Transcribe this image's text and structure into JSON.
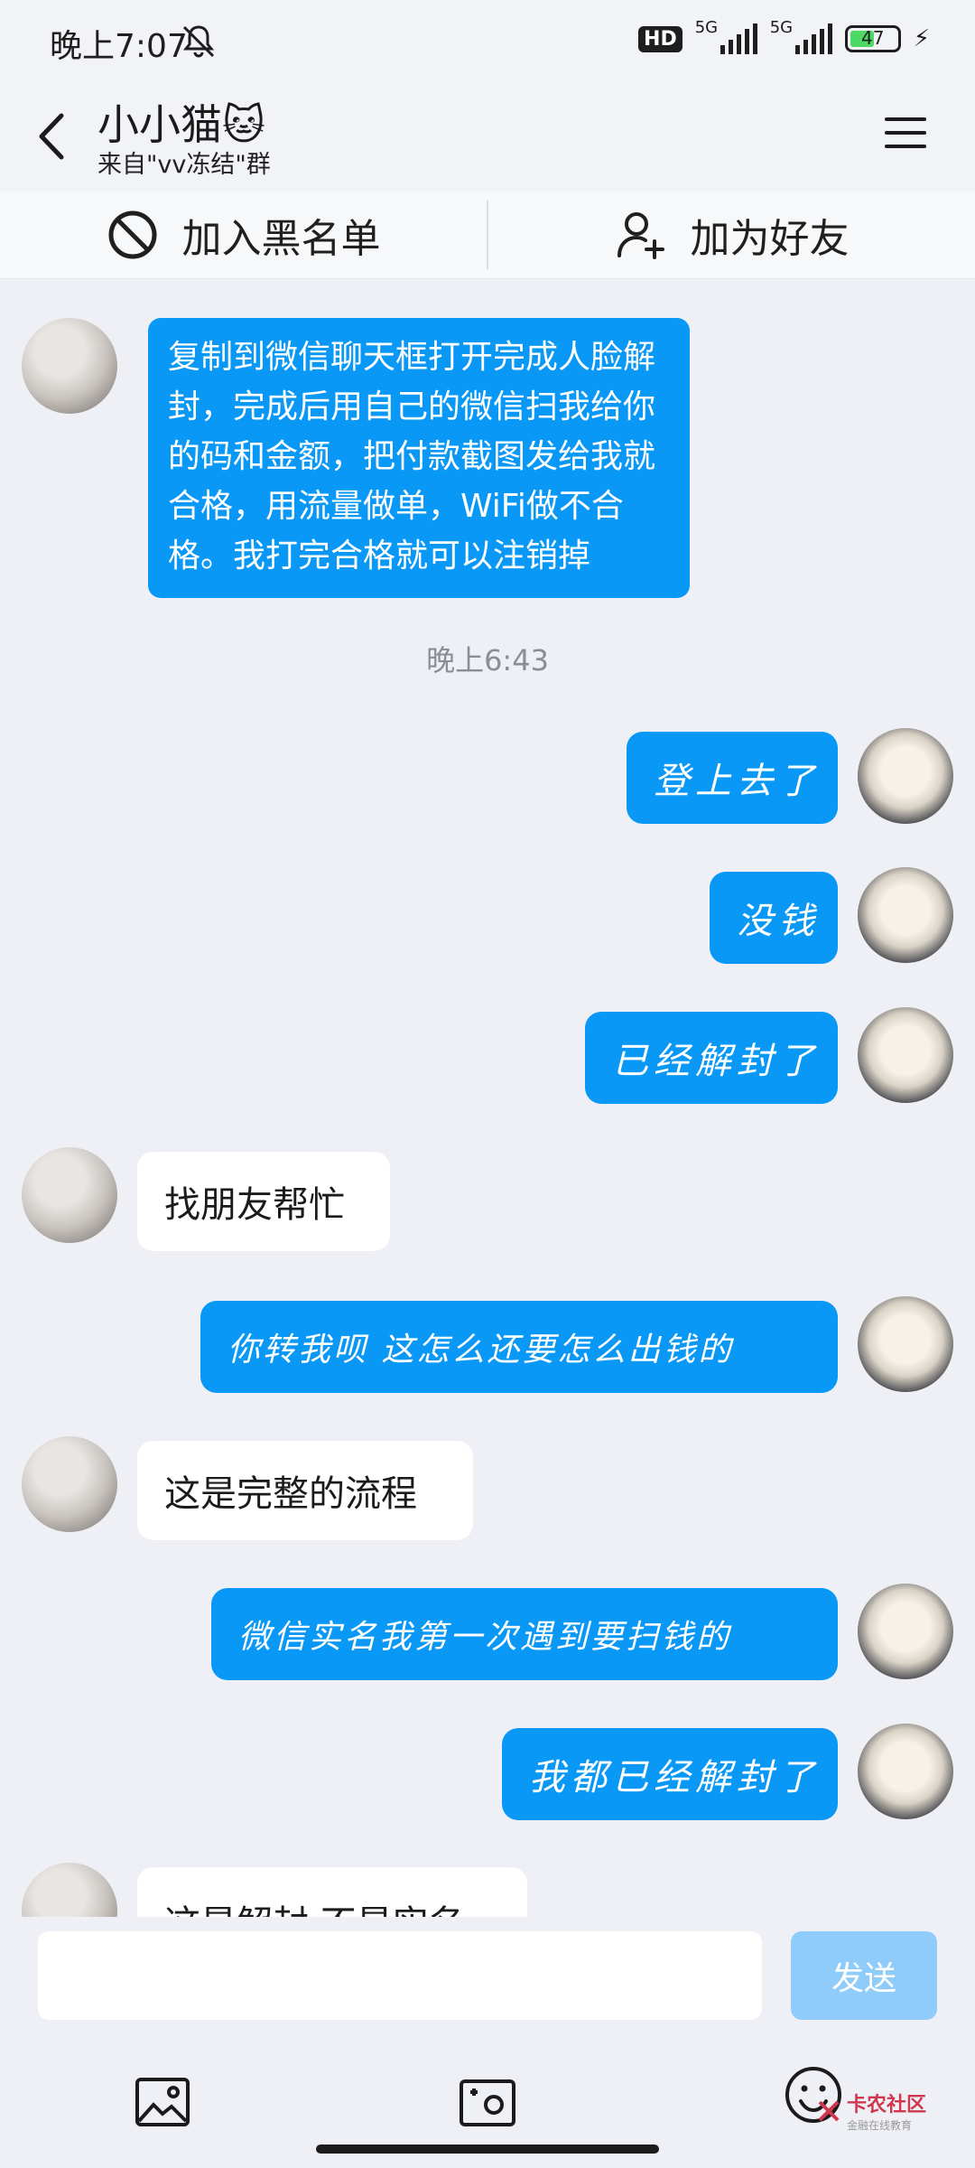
{
  "status_bar": {
    "time": "晚上7:07",
    "hd_label": "HD",
    "signal1_label": "5G",
    "signal2_label": "5G",
    "battery_level": "47"
  },
  "header": {
    "title": "小小猫🐱",
    "subtitle": "来自\"vv冻结\"群"
  },
  "actions": {
    "blacklist_label": "加入黑名单",
    "add_friend_label": "加为好友"
  },
  "messages": [
    {
      "sender": "other",
      "text": "复制到微信聊天框打开完成人脸解封，完成后用自己的微信扫我给你的码和金额，把付款截图发给我就合格，用流量做单，WiFi做不合格。我打完合格就可以注销掉"
    },
    {
      "sender": "system",
      "text": "晚上6:43"
    },
    {
      "sender": "me",
      "text": "登上去了"
    },
    {
      "sender": "me",
      "text": "没钱"
    },
    {
      "sender": "me",
      "text": "已经解封了"
    },
    {
      "sender": "other",
      "text": "找朋友帮忙"
    },
    {
      "sender": "me",
      "text": "你转我呗 这怎么还要怎么出钱的"
    },
    {
      "sender": "other",
      "text": "这是完整的流程"
    },
    {
      "sender": "me",
      "text": "微信实名我第一次遇到要扫钱的"
    },
    {
      "sender": "me",
      "text": "我都已经解封了"
    },
    {
      "sender": "other",
      "text": "这是解封 不是实名"
    }
  ],
  "input": {
    "value": "",
    "send_label": "发送"
  },
  "watermark": {
    "main": "卡农社区",
    "sub": "金融在线教育"
  },
  "colors": {
    "bubble_blue": "#0998f6",
    "send_disabled": "#8fccf9",
    "background": "#eef0f5"
  }
}
